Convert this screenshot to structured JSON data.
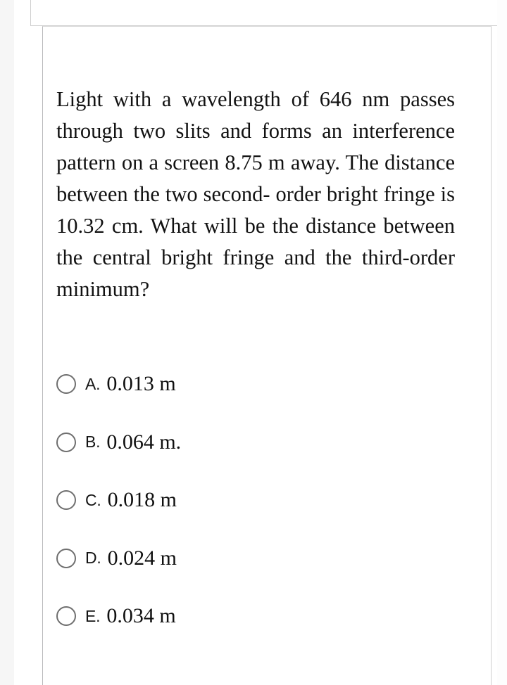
{
  "page": {
    "background_color": "#ffffff",
    "gutter_color": "#f6f6f6",
    "border_color": "#cfcfcf",
    "scrollbar_color": "#c4c4c6"
  },
  "header": {
    "title": ""
  },
  "question": {
    "text": "Light with a wavelength of 646 nm passes through two slits and forms an interference pattern on a screen 8.75 m away. The distance between the two second- order bright fringe is 10.32 cm. What will be the distance between the central bright fringe and the third-order minimum?"
  },
  "options": [
    {
      "letter": "A.",
      "value": "0.013 m",
      "selected": false
    },
    {
      "letter": "B.",
      "value": "0.064 m.",
      "selected": false
    },
    {
      "letter": "C.",
      "value": "0.018 m",
      "selected": false
    },
    {
      "letter": "D.",
      "value": "0.024 m",
      "selected": false
    },
    {
      "letter": "E.",
      "value": "0.034 m",
      "selected": false
    }
  ]
}
